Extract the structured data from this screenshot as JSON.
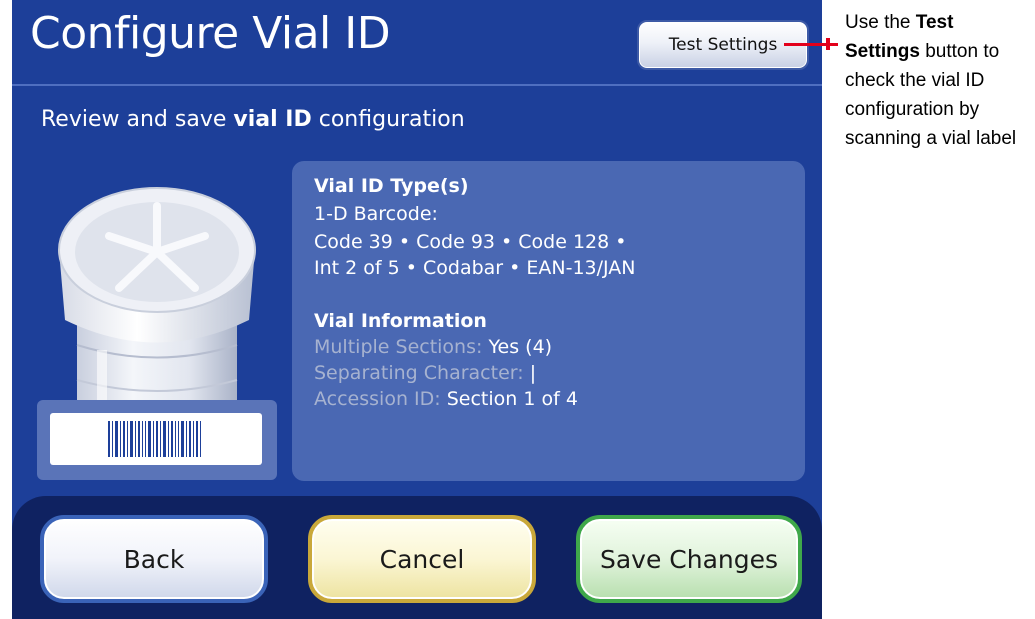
{
  "screen": {
    "title": "Configure Vial ID",
    "test_settings_label": "Test Settings",
    "subtitle_pre": "Review and save ",
    "subtitle_bold": "vial ID",
    "subtitle_post": " configuration"
  },
  "info": {
    "types_heading": "Vial ID Type(s)",
    "barcode_label": "1-D Barcode:",
    "barcode_line1": "Code 39 • Code 93 • Code 128 •",
    "barcode_line2": "Int 2 of 5 • Codabar • EAN-13/JAN",
    "vial_info_heading": "Vial Information",
    "multiple_sections_label": "Multiple Sections:",
    "multiple_sections_value": "Yes (4)",
    "separating_label": "Separating Character:",
    "separating_value": "|",
    "accession_label": "Accession ID:",
    "accession_value": "Section 1 of 4"
  },
  "buttons": {
    "back": "Back",
    "cancel": "Cancel",
    "save": "Save Changes"
  },
  "callout": {
    "pre": "Use the ",
    "bold": "Test Settings",
    "post": " button to check the vial ID configuration by scanning a vial label"
  },
  "icons": {
    "vial": "vial-illustration",
    "barcode": "barcode-icon"
  },
  "colors": {
    "screen_bg": "#1d3f99",
    "panel_bg": "#4a68b3",
    "callout_line": "#e3001b",
    "back_border": "#3a63b8",
    "cancel_border": "#c9a83a",
    "save_border": "#3fa84a"
  }
}
